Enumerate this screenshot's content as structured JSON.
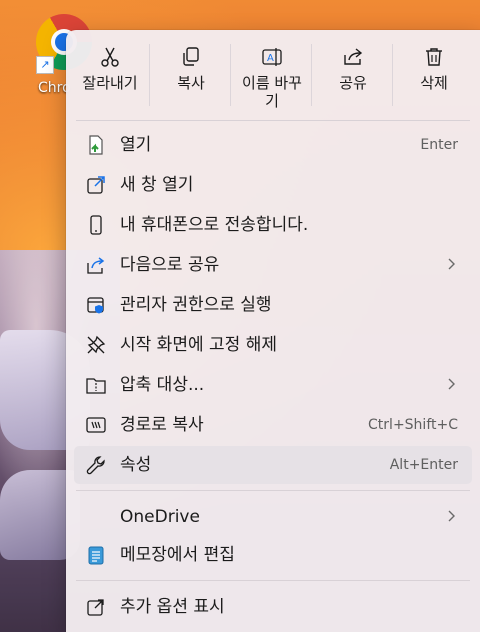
{
  "desktop": {
    "icon_label": "Chro"
  },
  "toolbar": {
    "cut": "잘라내기",
    "copy": "복사",
    "rename_line1": "이름 바꾸",
    "rename_line2": "기",
    "share": "공유",
    "delete": "삭제"
  },
  "items": {
    "open": {
      "label": "열기",
      "shortcut": "Enter"
    },
    "new_window": {
      "label": "새 창 열기"
    },
    "send_phone": {
      "label": "내 휴대폰으로 전송합니다."
    },
    "share_with": {
      "label": "다음으로 공유"
    },
    "run_admin": {
      "label": "관리자 권한으로 실행"
    },
    "unpin_start": {
      "label": "시작 화면에 고정 해제"
    },
    "compress": {
      "label": "압축 대상..."
    },
    "copy_path": {
      "label": "경로로 복사",
      "shortcut": "Ctrl+Shift+C"
    },
    "properties": {
      "label": "속성",
      "shortcut": "Alt+Enter"
    },
    "onedrive": {
      "label": "OneDrive"
    },
    "notepad": {
      "label": "메모장에서 편집"
    },
    "more_options": {
      "label": "추가 옵션 표시"
    }
  },
  "colors": {
    "menu_bg": "#f3ecf0",
    "accent_blue": "#1a73e8",
    "open_icon_green": "#2e9b3a",
    "hover_bg": "#e6e1e6"
  }
}
